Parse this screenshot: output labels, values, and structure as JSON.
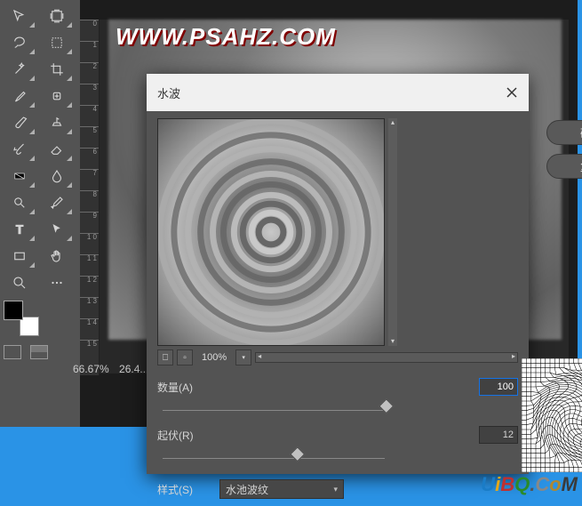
{
  "app": {
    "watermark": "WWW.PSAHZ.COM",
    "zoom": "66.67%",
    "doc_info": "26.4..."
  },
  "tools": [
    [
      "move",
      "artboard"
    ],
    [
      "lasso",
      "rect-marquee"
    ],
    [
      "magic-wand",
      "crop"
    ],
    [
      "eyedropper",
      "spot-heal"
    ],
    [
      "brush",
      "clone-stamp"
    ],
    [
      "history-brush",
      "eraser"
    ],
    [
      "gradient",
      "blur"
    ],
    [
      "dodge",
      "pen"
    ],
    [
      "type",
      "path-select"
    ],
    [
      "rectangle",
      "hand"
    ],
    [
      "zoom",
      "options"
    ]
  ],
  "dialog": {
    "title": "水波",
    "close_aria": "关闭",
    "ok": "确定",
    "reset": "复位",
    "amount_label": "数量(A)",
    "amount_value": "100",
    "ridges_label": "起伏(R)",
    "ridges_value": "12",
    "style_label": "样式(S)",
    "style_value": "水池波纹",
    "zoom_level": "100%"
  },
  "ruler_marks": [
    "0",
    "1",
    "2",
    "3",
    "4",
    "5",
    "6",
    "7",
    "8",
    "9",
    "1 0",
    "1 1",
    "1 2",
    "1 3",
    "1 4",
    "1 5"
  ],
  "uibq": "UiBQ.CoM"
}
